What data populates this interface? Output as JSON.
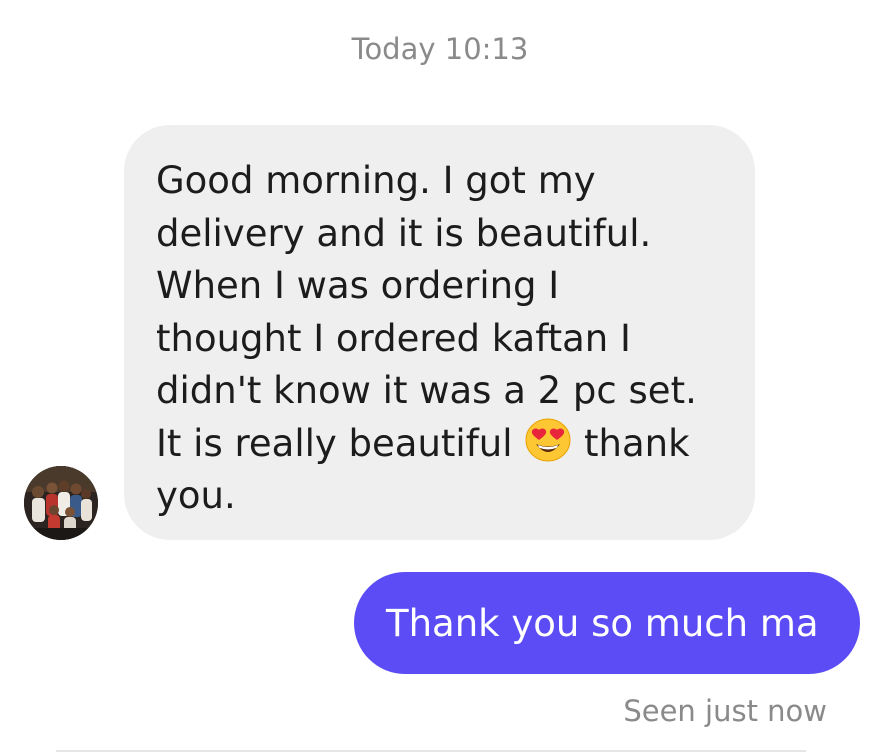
{
  "conversation": {
    "timestamp": "Today 10:13",
    "incoming_message": {
      "lines": [
        "Good morning.  I got my",
        "delivery and it is beautiful.",
        "When I was ordering I",
        "thought I ordered kaftan I",
        "didn't know it was a 2 pc set.",
        "It is really beautiful",
        "thank",
        "you."
      ],
      "emoji": "smiling-face-with-heart-eyes-icon",
      "bubble_color": "#efefef"
    },
    "sender_avatar": "group-photo-avatar",
    "outgoing_message": {
      "text": "Thank you so much ma",
      "bubble_color": "#5b4cf5"
    },
    "read_receipt": "Seen just now"
  }
}
